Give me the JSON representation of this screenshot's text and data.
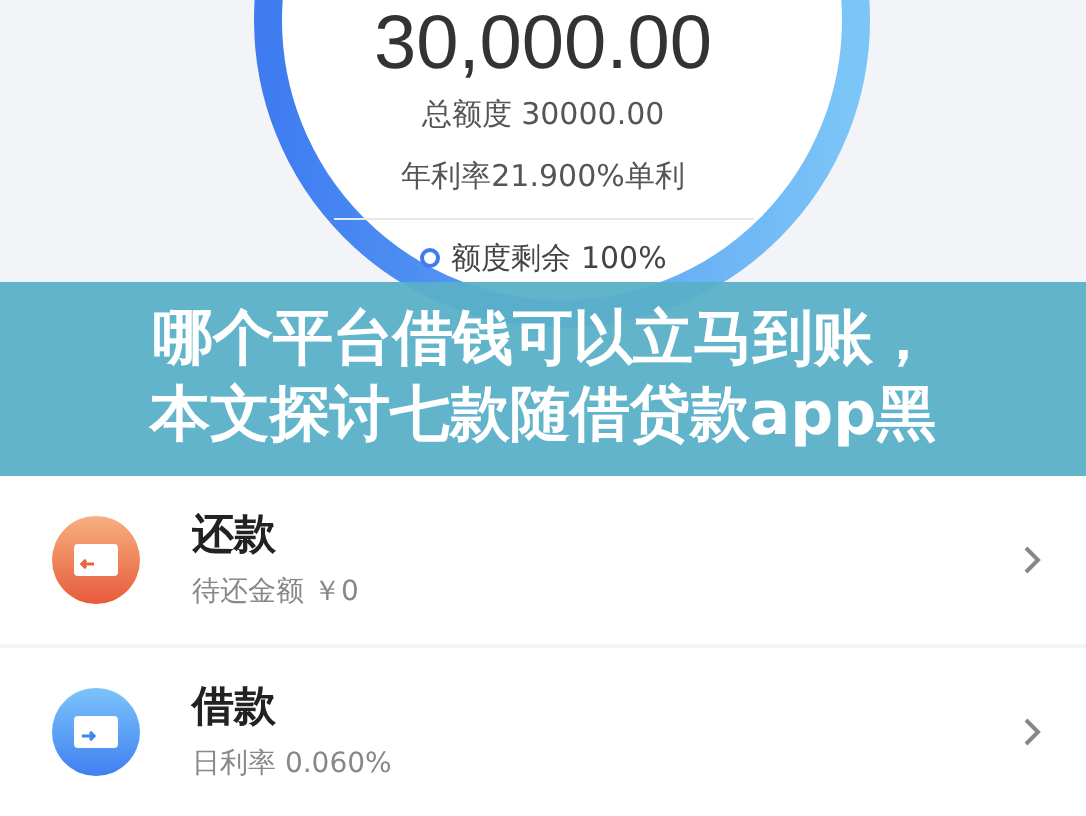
{
  "credit": {
    "amount": "30,000.00",
    "total": "总额度 30000.00",
    "rate": "年利率21.900%单利",
    "remaining": "额度剩余 100%"
  },
  "banner": {
    "lines": [
      "哪个平台借钱可以立马到账，",
      "本文探讨七款随借贷款app黑"
    ]
  },
  "actions": [
    {
      "kind": "repay",
      "title": "还款",
      "subtitle": "待还金额 ￥0"
    },
    {
      "kind": "borrow",
      "title": "借款",
      "subtitle": "日利率 0.060%"
    }
  ]
}
